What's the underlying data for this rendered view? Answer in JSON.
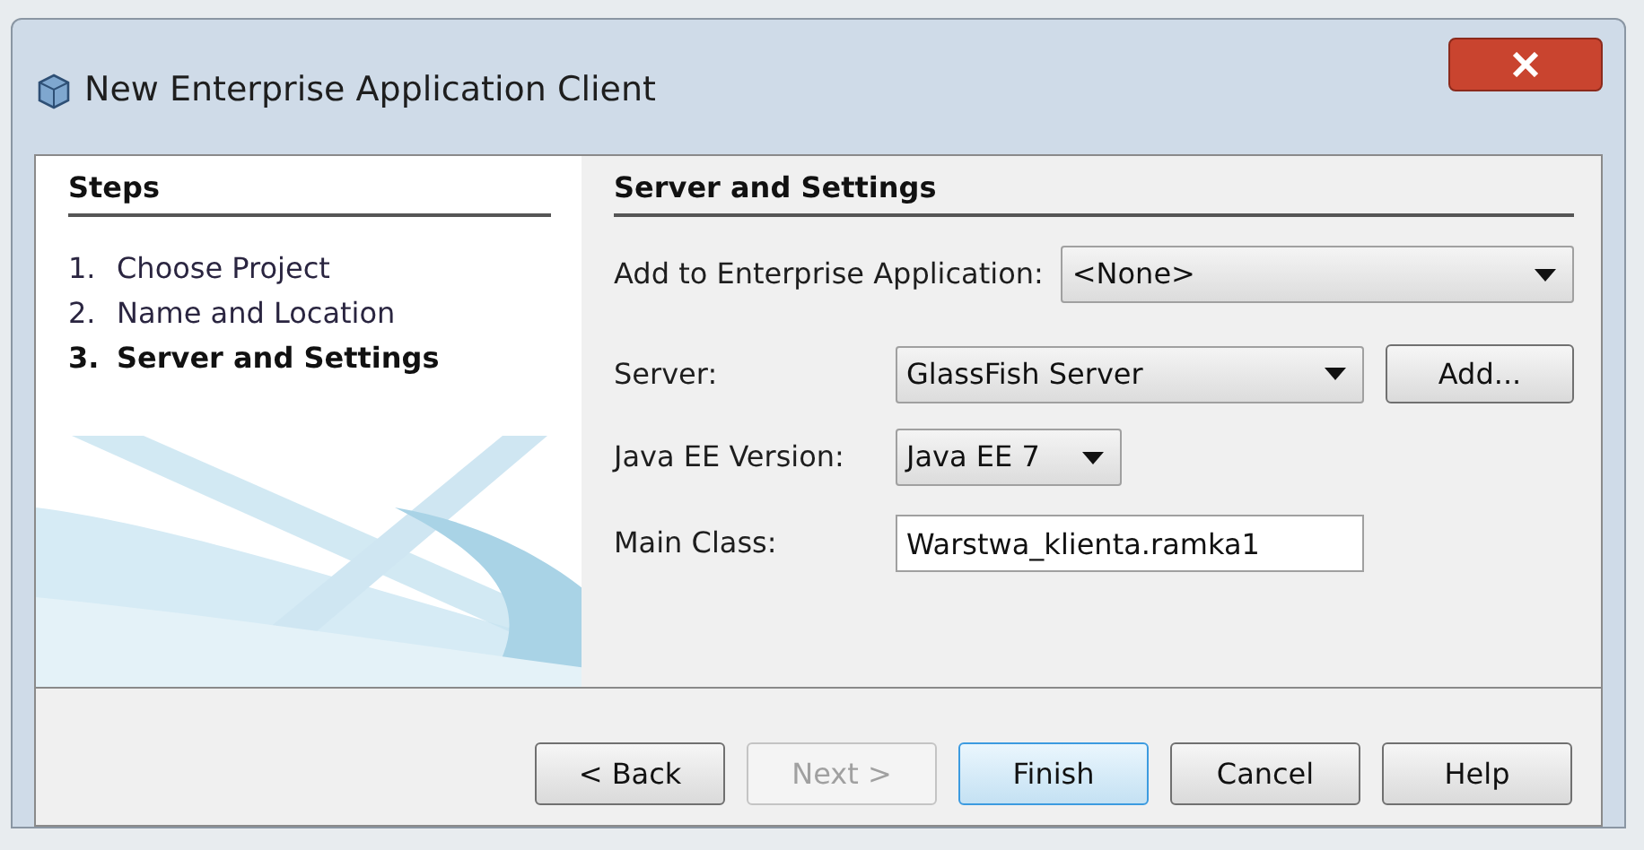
{
  "window": {
    "title": "New Enterprise Application Client"
  },
  "steps": {
    "title": "Steps",
    "items": [
      {
        "number": "1.",
        "label": "Choose Project",
        "selected": false
      },
      {
        "number": "2.",
        "label": "Name and Location",
        "selected": false
      },
      {
        "number": "3.",
        "label": "Server and Settings",
        "selected": true
      }
    ]
  },
  "panel": {
    "title": "Server and Settings",
    "fields": [
      {
        "kind": "dropdown",
        "label": "Add to Enterprise Application:",
        "value": "<None>"
      },
      {
        "kind": "dropdown",
        "label": "Server:",
        "value": "GlassFish Server",
        "button": "Add..."
      },
      {
        "kind": "dropdown",
        "label": "Java EE Version:",
        "value": "Java EE 7"
      },
      {
        "kind": "text",
        "label": "Main Class:",
        "value": "Warstwa_klienta.ramka1"
      }
    ]
  },
  "buttons": [
    {
      "label": "< Back",
      "disabled": false,
      "default": false
    },
    {
      "label": "Next >",
      "disabled": true,
      "default": false
    },
    {
      "label": "Finish",
      "disabled": false,
      "default": true
    },
    {
      "label": "Cancel",
      "disabled": false,
      "default": false
    },
    {
      "label": "Help",
      "disabled": false,
      "default": false
    }
  ]
}
